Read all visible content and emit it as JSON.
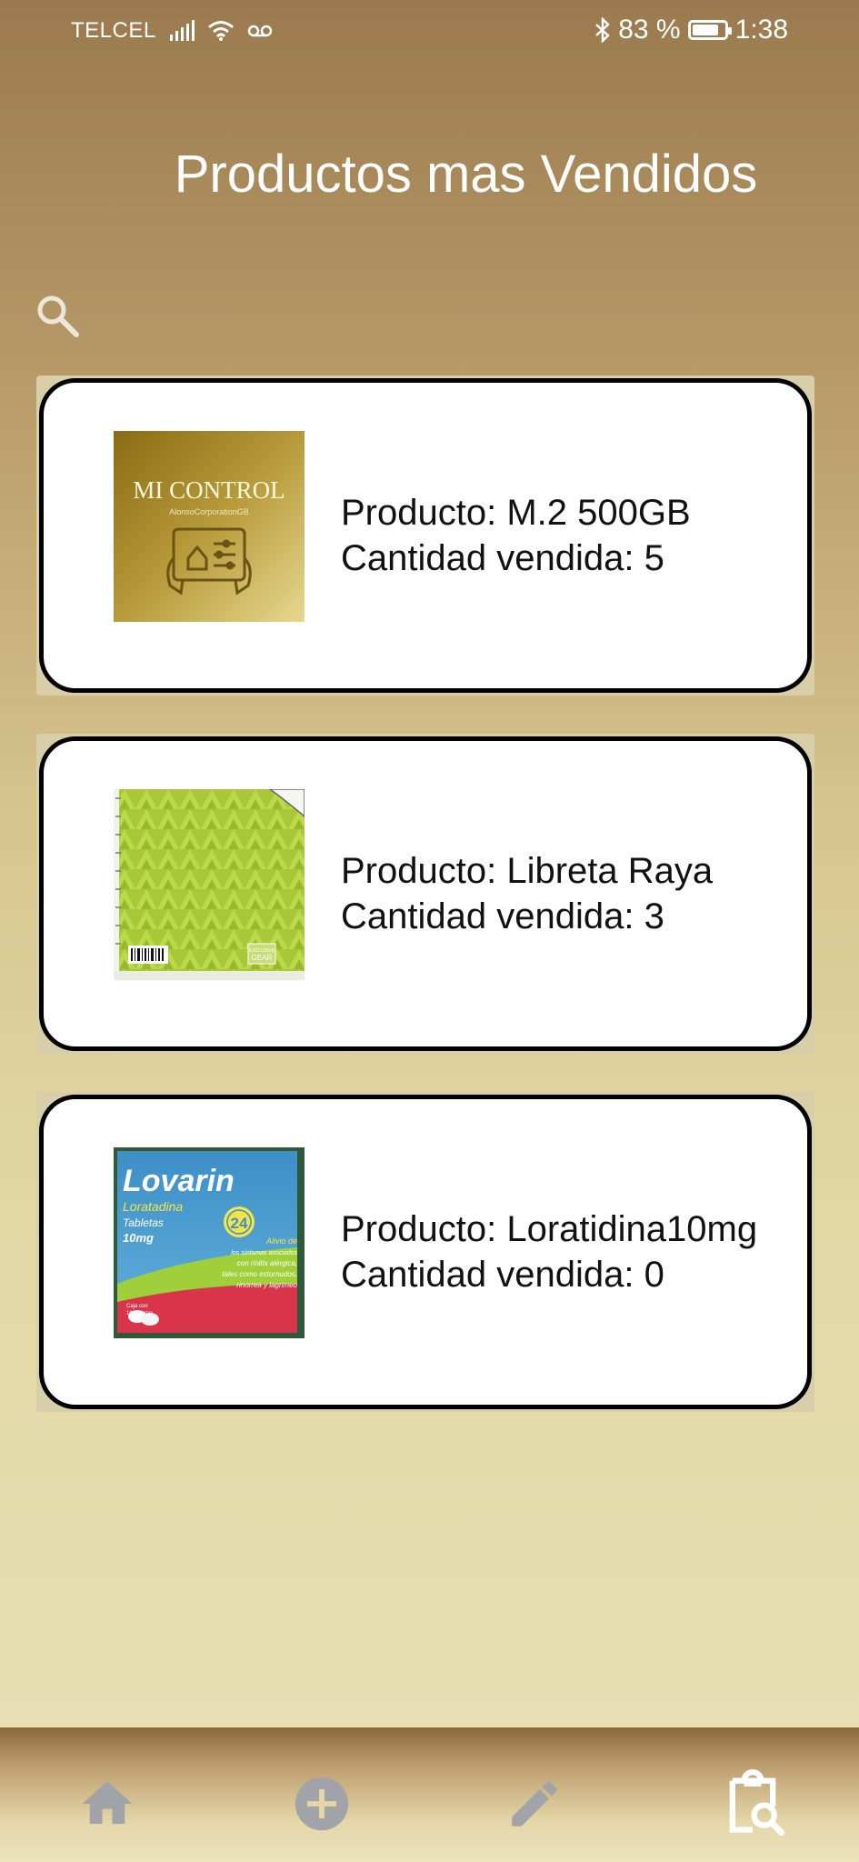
{
  "status_bar": {
    "carrier": "TELCEL",
    "battery_percent": "83 %",
    "battery_level": 0.83,
    "time": "1:38"
  },
  "header": {
    "title": "Productos mas Vendidos",
    "search_icon": "search-icon"
  },
  "products": [
    {
      "product_text": "Producto: M.2 500GB",
      "quantity_text": "Cantidad vendida: 5",
      "image": {
        "headline": "MI CONTROL",
        "subline": "AlonsoCorporationGB"
      }
    },
    {
      "product_text": "Producto: Libreta Raya",
      "quantity_text": "Cantidad vendida: 3",
      "image": {
        "badge_line1": "EXCLUSIVE",
        "badge_line2": "GEAR"
      }
    },
    {
      "product_text": "Producto: Loratidina10mg",
      "quantity_text": "Cantidad vendida: 0",
      "image": {
        "brand": "Lovarin",
        "generic": "Loratadina",
        "form": "Tabletas",
        "dose": "10mg",
        "hours": "24",
        "blurb1": "Alivio de",
        "blurb2": "los síntomas asociados",
        "blurb3": "con rinitis alérgica,",
        "blurb4": "tales como estornudos,",
        "blurb5": "rinorrea y lagrimeo",
        "pack": "Caja con",
        "pack2": "10 tabletas"
      }
    }
  ],
  "bottom_nav": {
    "items": [
      {
        "icon": "home-icon"
      },
      {
        "icon": "add-circle-icon"
      },
      {
        "icon": "edit-icon"
      },
      {
        "icon": "clipboard-search-icon",
        "active": true
      }
    ],
    "active_color": "#ffffff",
    "inactive_color": "#a0a4a8"
  }
}
